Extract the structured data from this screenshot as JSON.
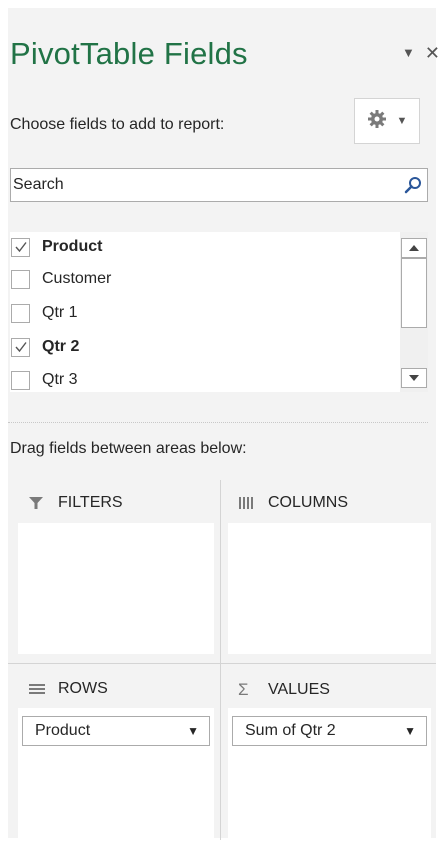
{
  "pane": {
    "title": "PivotTable Fields",
    "subtitle": "Choose fields to add to report:",
    "search_placeholder": "Search",
    "drag_label": "Drag fields between areas below:"
  },
  "fields": [
    {
      "label": "Product",
      "checked": true
    },
    {
      "label": "Customer",
      "checked": false
    },
    {
      "label": "Qtr 1",
      "checked": false
    },
    {
      "label": "Qtr 2",
      "checked": true
    },
    {
      "label": "Qtr 3",
      "checked": false
    }
  ],
  "areas": {
    "filters": {
      "label": "FILTERS",
      "icon": "filter-icon"
    },
    "columns": {
      "label": "COLUMNS",
      "icon": "columns-icon"
    },
    "rows": {
      "label": "ROWS",
      "icon": "rows-icon",
      "items": [
        "Product"
      ]
    },
    "values": {
      "label": "VALUES",
      "icon": "sigma-icon",
      "items": [
        "Sum of Qtr 2"
      ]
    }
  },
  "colors": {
    "title": "#217346",
    "pane_bg": "#f3f3f3",
    "border": "#ababab"
  }
}
